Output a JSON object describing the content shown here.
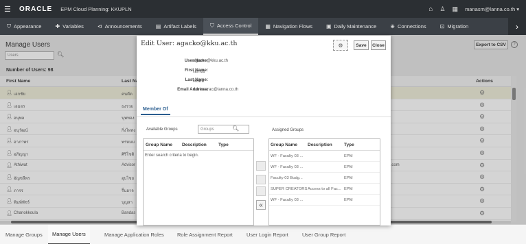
{
  "header": {
    "logo": "ORACLE",
    "app_title": "EPM Cloud Planning:  KKUPLN",
    "user": "manasm@lanna.co.th"
  },
  "nav": {
    "tabs": [
      {
        "label": "Appearance",
        "icon": "appearance-icon",
        "glyph": "⛉"
      },
      {
        "label": "Variables",
        "icon": "variables-icon",
        "glyph": "✚"
      },
      {
        "label": "Announcements",
        "icon": "announcements-icon",
        "glyph": "⊲"
      },
      {
        "label": "Artifact Labels",
        "icon": "artifact-labels-icon",
        "glyph": "▤"
      },
      {
        "label": "Access Control",
        "icon": "access-control-icon",
        "glyph": "⛉"
      },
      {
        "label": "Navigation Flows",
        "icon": "navigation-flows-icon",
        "glyph": "▦"
      },
      {
        "label": "Daily Maintenance",
        "icon": "daily-maintenance-icon",
        "glyph": "▣"
      },
      {
        "label": "Connections",
        "icon": "connections-icon",
        "glyph": "⊕"
      },
      {
        "label": "Migration",
        "icon": "migration-icon",
        "glyph": "⊡"
      }
    ],
    "active": "Access Control"
  },
  "page": {
    "title": "Manage Users",
    "search_placeholder": "Users",
    "export_label": "Export to CSV",
    "count_label": "Number of Users: 98",
    "columns": {
      "first": "First Name",
      "last": "Last Na",
      "actions": "Actions"
    },
    "rows": [
      {
        "first": "เอกชัย",
        "last": "คนดีด",
        "email": ""
      },
      {
        "first": "เอมอร",
        "last": "ธงรวย",
        "email": ""
      },
      {
        "first": "อนุพล",
        "last": "นุพทอง",
        "email": ""
      },
      {
        "first": "อนุวัฒน์",
        "last": "กิ่งไทสง",
        "email": ""
      },
      {
        "first": "อาภาพร",
        "last": "พรหมม",
        "email": ""
      },
      {
        "first": "อภิญญา",
        "last": "ศิริโชติ",
        "email": ""
      },
      {
        "first": "Athiwat",
        "last": "Advisor",
        "email": "ll.com"
      },
      {
        "first": "อัญชลีพร",
        "last": "อุบไชย",
        "email": ""
      },
      {
        "first": "ภารร",
        "last": "รื่นอาจ",
        "email": ""
      },
      {
        "first": "พิมพ์พัชร์",
        "last": "บุญสา",
        "email": ""
      },
      {
        "first": "Chanokkoula",
        "last": "Bandas",
        "email": ""
      }
    ]
  },
  "dialog": {
    "title": "Edit User: agacko@kku.ac.th",
    "save_label": "Save",
    "close_label": "Close",
    "fields": [
      {
        "label": "User Name:",
        "value": "agacko@kku.ac.th"
      },
      {
        "label": "First Name:",
        "value": "เอกชัย"
      },
      {
        "label": "Last Name:",
        "value": "คนดีด"
      },
      {
        "label": "Email Address:",
        "value": "warissarac@lanna.co.th"
      }
    ],
    "member_tab": "Member Of",
    "available_label": "Available Groups",
    "available_placeholder": "Groups",
    "assigned_label": "Assigned Groups",
    "columns": {
      "name": "Group Name",
      "desc": "Description",
      "type": "Type"
    },
    "available_hint": "Enter search criteria to begin.",
    "assigned": [
      {
        "name": "WF - Faculty 03 ...",
        "desc": "",
        "type": "EPM"
      },
      {
        "name": "WF - Faculty 03 ...",
        "desc": "",
        "type": "EPM"
      },
      {
        "name": "Faculty 03 Budg...",
        "desc": "",
        "type": "EPM"
      },
      {
        "name": "SUPER CREATORS",
        "desc": "Access to all Fac...",
        "type": "EPM"
      },
      {
        "name": "WF - Faculty 03 ...",
        "desc": "",
        "type": "EPM"
      }
    ]
  },
  "bottom_tabs": [
    "Manage Groups",
    "Manage Users",
    "Manage Application Roles",
    "Role Assignment Report",
    "User Login Report",
    "User Group Report"
  ],
  "bottom_active": "Manage Users"
}
